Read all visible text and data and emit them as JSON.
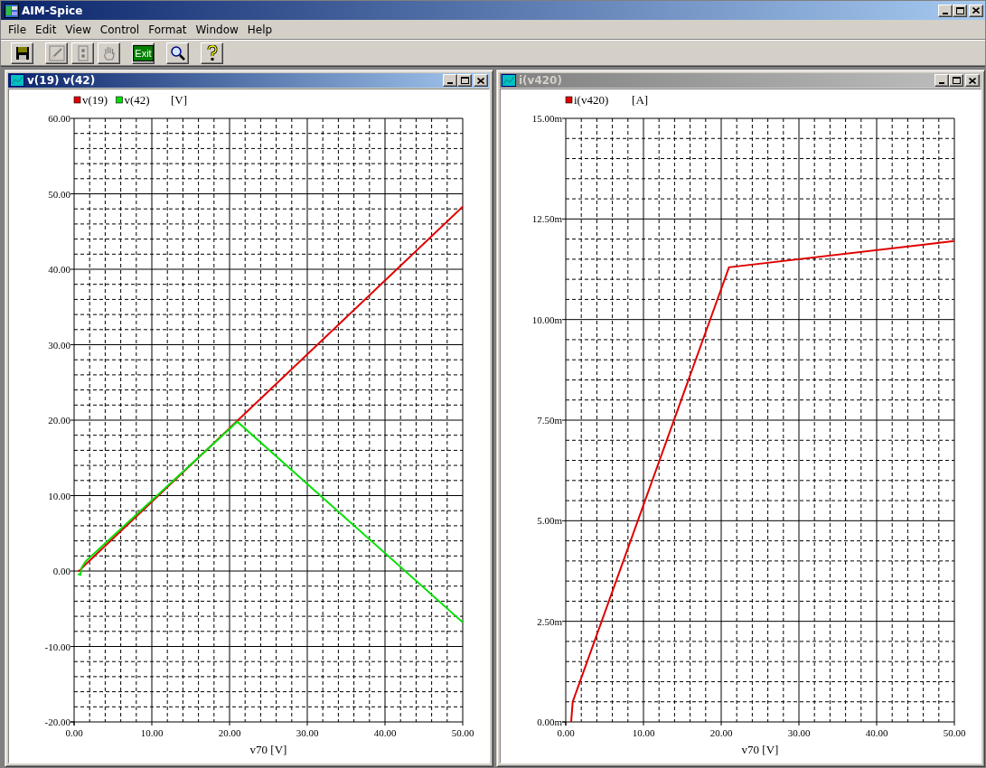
{
  "window": {
    "title": "AIM-Spice"
  },
  "menu": [
    "File",
    "Edit",
    "View",
    "Control",
    "Format",
    "Window",
    "Help"
  ],
  "toolbar": [
    {
      "kind": "save",
      "disabled": false
    },
    {
      "kind": "edit",
      "disabled": true
    },
    {
      "kind": "meter",
      "disabled": true
    },
    {
      "kind": "hand",
      "disabled": true
    },
    {
      "kind": "exit",
      "label": "Exit",
      "disabled": false
    },
    {
      "kind": "zoom",
      "disabled": false
    },
    {
      "kind": "help",
      "disabled": false
    }
  ],
  "plot_windows": [
    {
      "title": "v(19) v(42)",
      "active": true,
      "chart_data": {
        "type": "line",
        "grid": true,
        "legend": true,
        "xlabel": "v70 [V]",
        "ylabel": "[V]",
        "x": [
          0.5,
          0.8,
          1.0,
          1.5,
          21,
          50
        ],
        "series": [
          {
            "name": "v(19)",
            "color": "#e00000",
            "values": [
              0,
              0.1,
              0.4,
              0.9,
              19.9,
              48.3
            ]
          },
          {
            "name": "v(42)",
            "color": "#00e000",
            "values": [
              -0.4,
              -0.5,
              0.5,
              1.3,
              19.8,
              -6.8
            ]
          }
        ],
        "xlim": [
          0,
          50
        ],
        "ylim": [
          -20,
          60
        ],
        "xticks": [
          {
            "value": 0,
            "label": "0.00"
          },
          {
            "value": 10,
            "label": "10.00"
          },
          {
            "value": 20,
            "label": "20.00"
          },
          {
            "value": 30,
            "label": "30.00"
          },
          {
            "value": 40,
            "label": "40.00"
          },
          {
            "value": 50,
            "label": "50.00"
          }
        ],
        "yticks": [
          {
            "value": -20,
            "label": "-20.00"
          },
          {
            "value": -10,
            "label": "-10.00"
          },
          {
            "value": 0,
            "label": "0.00"
          },
          {
            "value": 10,
            "label": "10.00"
          },
          {
            "value": 20,
            "label": "20.00"
          },
          {
            "value": 30,
            "label": "30.00"
          },
          {
            "value": 40,
            "label": "40.00"
          },
          {
            "value": 50,
            "label": "50.00"
          },
          {
            "value": 60,
            "label": "60.00"
          }
        ]
      }
    },
    {
      "title": "i(v420)",
      "active": false,
      "chart_data": {
        "type": "line",
        "grid": true,
        "legend": true,
        "xlabel": "v70 [V]",
        "ylabel": "[A]",
        "x": [
          0.7,
          0.9,
          21,
          50
        ],
        "series": [
          {
            "name": "i(v420)",
            "color": "#e00000",
            "values": [
              0,
              0.5,
              11.3,
              11.95
            ]
          }
        ],
        "xlim": [
          0,
          50
        ],
        "ylim": [
          0,
          15
        ],
        "xticks": [
          {
            "value": 0,
            "label": "0.00"
          },
          {
            "value": 10,
            "label": "10.00"
          },
          {
            "value": 20,
            "label": "20.00"
          },
          {
            "value": 30,
            "label": "30.00"
          },
          {
            "value": 40,
            "label": "40.00"
          },
          {
            "value": 50,
            "label": "50.00"
          }
        ],
        "yticks": [
          {
            "value": 0,
            "label": "0.00m"
          },
          {
            "value": 2.5,
            "label": "2.50m"
          },
          {
            "value": 5,
            "label": "5.00m"
          },
          {
            "value": 7.5,
            "label": "7.50m"
          },
          {
            "value": 10,
            "label": "10.00m"
          },
          {
            "value": 12.5,
            "label": "12.50m"
          },
          {
            "value": 15,
            "label": "15.00m"
          }
        ]
      }
    }
  ]
}
